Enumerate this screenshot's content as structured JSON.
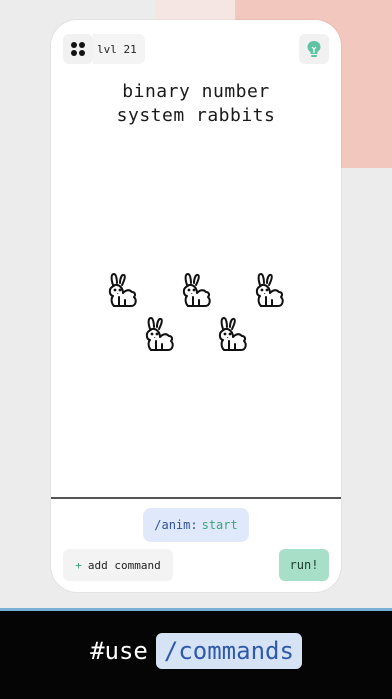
{
  "header": {
    "level_label": "lvl 21"
  },
  "icons": {
    "menu": "grid-icon",
    "hint": "lightbulb-icon",
    "rabbit": "rabbit-icon"
  },
  "puzzle": {
    "title_line1": "binary number",
    "title_line2": "system rabbits",
    "rabbit_count": 5
  },
  "command_chip": {
    "command": "/anim:",
    "argument": "start"
  },
  "actions": {
    "add_command_plus": "+",
    "add_command_label": "add command",
    "run_label": "run!"
  },
  "footer": {
    "prefix": "#use",
    "highlight": "/commands"
  },
  "colors": {
    "accent_green": "#3aa37a",
    "chip_blue": "#dfe9fb",
    "run_bg": "#a8dfc8",
    "footer_bg": "#050505"
  }
}
